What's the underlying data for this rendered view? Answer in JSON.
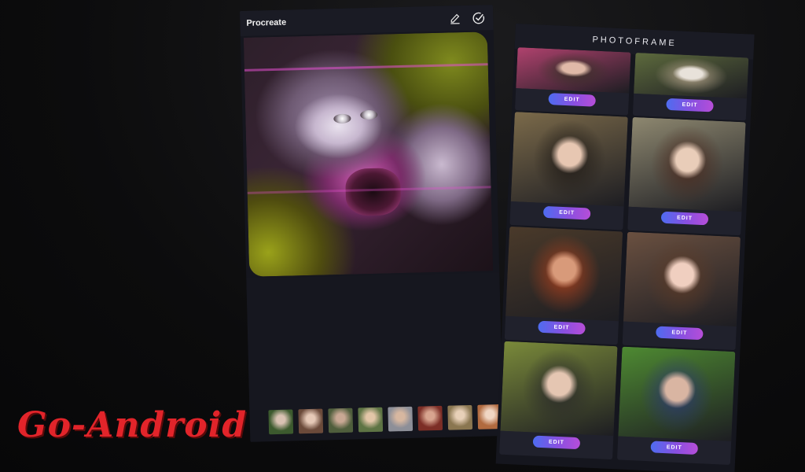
{
  "editor": {
    "title": "Procreate",
    "thumbnails": [
      {
        "colors": [
          "#3c5a2e",
          "#d9c2b3"
        ]
      },
      {
        "colors": [
          "#6b4a3a",
          "#e6c9b7"
        ]
      },
      {
        "colors": [
          "#4f5e3c",
          "#c9a894"
        ]
      },
      {
        "colors": [
          "#5e7444",
          "#e3c6a8"
        ]
      },
      {
        "colors": [
          "#8d8f98",
          "#d7b7a0"
        ]
      },
      {
        "colors": [
          "#7c2e26",
          "#d8a48f"
        ]
      },
      {
        "colors": [
          "#8a7650",
          "#e8d0b8"
        ]
      },
      {
        "colors": [
          "#b16a3f",
          "#f0d6c4"
        ]
      }
    ]
  },
  "photoframe": {
    "title": "PHOTOFRAME",
    "edit_label": "EDIT",
    "cards": [
      {
        "colors": [
          "#b0426e",
          "#e0b9a8",
          "#3a3228"
        ]
      },
      {
        "colors": [
          "#5d6a3d",
          "#e8e2da",
          "#b5a48c"
        ]
      },
      {
        "colors": [
          "#7b6a4a",
          "#e7c7b2",
          "#1f1a16"
        ]
      },
      {
        "colors": [
          "#8e8870",
          "#e9cdb9",
          "#4a2a1f"
        ]
      },
      {
        "colors": [
          "#4a3a2a",
          "#d89a7a",
          "#a8401e"
        ]
      },
      {
        "colors": [
          "#6a5040",
          "#f0cfc0",
          "#5a3a28"
        ]
      },
      {
        "colors": [
          "#7a8a3a",
          "#e5c6b2",
          "#2a2a2a"
        ]
      },
      {
        "colors": [
          "#4e8a32",
          "#d9b5a2",
          "#2c3a70"
        ]
      }
    ]
  },
  "brand": {
    "text": "Go-Android",
    "color": "#e2242a"
  }
}
